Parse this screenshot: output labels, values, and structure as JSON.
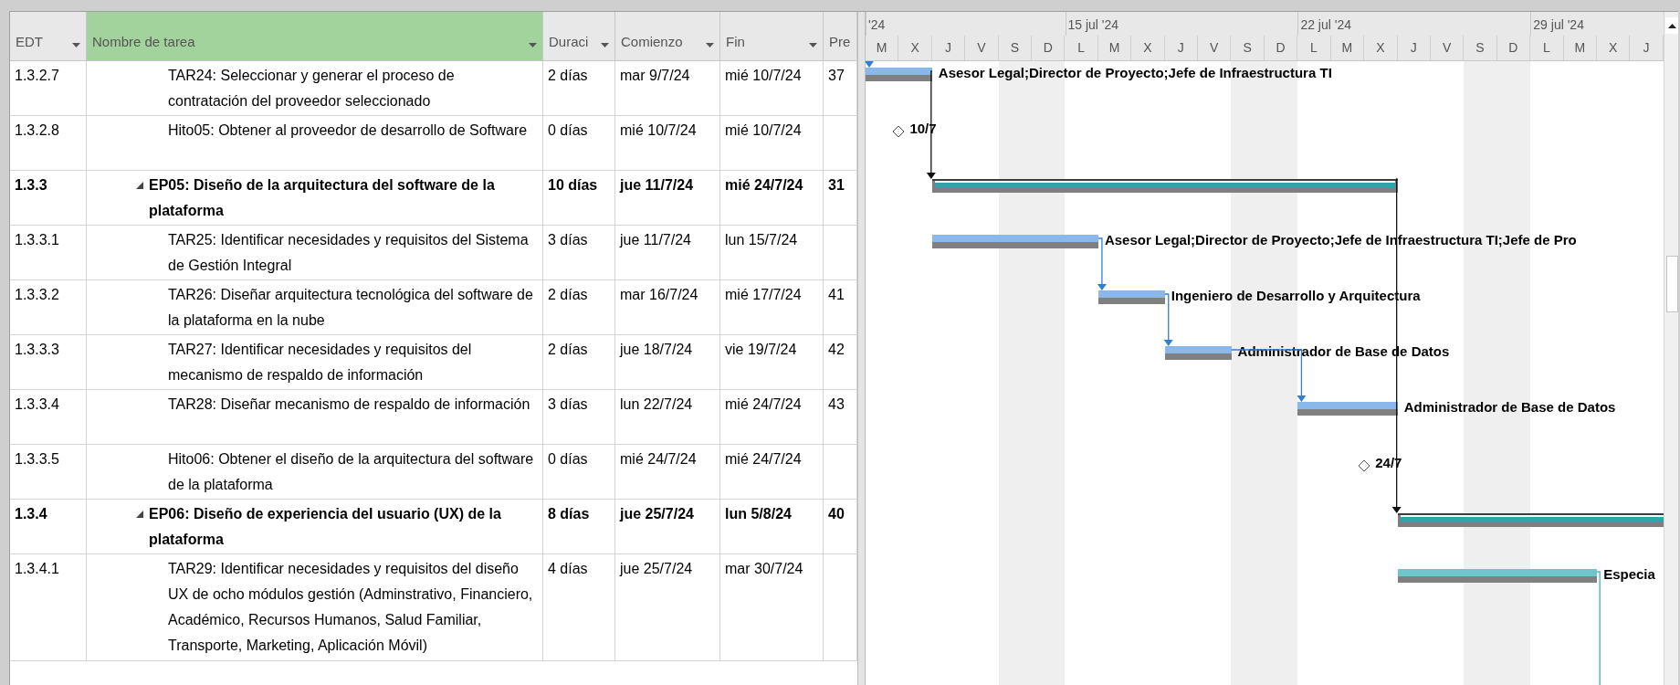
{
  "table": {
    "columns": [
      {
        "label": "EDT",
        "selected": false
      },
      {
        "label": "Nombre de tarea",
        "selected": true
      },
      {
        "label": "Duraci",
        "selected": false
      },
      {
        "label": "Comienzo",
        "selected": false
      },
      {
        "label": "Fin",
        "selected": false
      },
      {
        "label": "Pre",
        "selected": false
      }
    ],
    "rows": [
      {
        "kind": "task",
        "wbs": "1.3.2.7",
        "name": "TAR24: Seleccionar y generar el proceso de contratación del proveedor seleccionado",
        "duration": "2 días",
        "start": "mar 9/7/24",
        "finish": "mié 10/7/24",
        "predecessors": "37",
        "color": "#8ab8ea",
        "resources": "Asesor Legal;Director de Proyecto;Jefe de Infraestructura TI",
        "arrow_in": true
      },
      {
        "kind": "milestone",
        "wbs": "1.3.2.8",
        "name": "Hito05: Obtener al proveedor de desarrollo de Software",
        "duration": "0 días",
        "start": "mié 10/7/24",
        "finish": "mié 10/7/24",
        "milestone_label": "10/7"
      },
      {
        "kind": "summary",
        "wbs": "1.3.3",
        "name": "EP05: Diseño de la arquitectura del software de la plataforma",
        "expanded": true,
        "duration": "10 días",
        "start": "jue 11/7/24",
        "finish": "mié 24/7/24",
        "predecessors": "31",
        "arrow_in": true
      },
      {
        "kind": "task",
        "wbs": "1.3.3.1",
        "name": "TAR25: Identificar necesidades y requisitos del Sistema de Gestión Integral",
        "duration": "3 días",
        "start": "jue 11/7/24",
        "finish": "lun 15/7/24",
        "color": "#8ab8ea",
        "resources": "Asesor Legal;Director de Proyecto;Jefe de Infraestructura TI;Jefe de Pro"
      },
      {
        "kind": "task",
        "wbs": "1.3.3.2",
        "name": "TAR26: Diseñar arquitectura tecnológica del software de la plataforma en la nube",
        "duration": "2 días",
        "start": "mar 16/7/24",
        "finish": "mié 17/7/24",
        "predecessors": "41",
        "color": "#8ab8ea",
        "resources": "Ingeniero de Desarrollo y Arquitectura",
        "arrow_in": true
      },
      {
        "kind": "task",
        "wbs": "1.3.3.3",
        "name": "TAR27: Identificar necesidades y requisitos del mecanismo de respaldo de información",
        "duration": "2 días",
        "start": "jue 18/7/24",
        "finish": "vie 19/7/24",
        "predecessors": "42",
        "color": "#8ab8ea",
        "resources": "Administrador de Base de Datos",
        "arrow_in": true
      },
      {
        "kind": "task",
        "wbs": "1.3.3.4",
        "name": "TAR28: Diseñar mecanismo de respaldo de información",
        "duration": "3 días",
        "start": "lun 22/7/24",
        "finish": "mié 24/7/24",
        "predecessors": "43",
        "color": "#8ab8ea",
        "resources": "Administrador de Base de Datos",
        "arrow_in": true
      },
      {
        "kind": "milestone",
        "wbs": "1.3.3.5",
        "name": "Hito06: Obtener el diseño de la arquitectura del software de la plataforma",
        "duration": "0 días",
        "start": "mié 24/7/24",
        "finish": "mié 24/7/24",
        "milestone_label": "24/7"
      },
      {
        "kind": "summary",
        "wbs": "1.3.4",
        "name": "EP06: Diseño de experiencia del usuario (UX) de la plataforma",
        "expanded": true,
        "duration": "8 días",
        "start": "jue 25/7/24",
        "finish": "lun 5/8/24",
        "predecessors": "40",
        "arrow_in": true
      },
      {
        "kind": "task",
        "wbs": "1.3.4.1",
        "name": "TAR29: Identificar necesidades y requisitos del diseño UX de ocho módulos gestión (Adminstrativo, Financiero, Académico, Recursos Humanos, Salud Familiar, Transporte, Marketing, Aplicación Móvil)",
        "duration": "4 días",
        "start": "jue 25/7/24",
        "finish": "mar 30/7/24",
        "color": "#6cc6cc",
        "resources": "Especia",
        "arrow_out": true
      }
    ]
  },
  "timeline": {
    "weeks": [
      {
        "label": "'24"
      },
      {
        "label": "15 jul '24"
      },
      {
        "label": "22 jul '24"
      },
      {
        "label": "29 jul '24"
      }
    ],
    "days": [
      {
        "label": "M",
        "weekend": false
      },
      {
        "label": "X",
        "weekend": false
      },
      {
        "label": "J",
        "weekend": false
      },
      {
        "label": "V",
        "weekend": false
      },
      {
        "label": "S",
        "weekend": true
      },
      {
        "label": "D",
        "weekend": true
      },
      {
        "label": "L",
        "weekend": false
      },
      {
        "label": "M",
        "weekend": false
      },
      {
        "label": "X",
        "weekend": false
      },
      {
        "label": "J",
        "weekend": false
      },
      {
        "label": "V",
        "weekend": false
      },
      {
        "label": "S",
        "weekend": true
      },
      {
        "label": "D",
        "weekend": true
      },
      {
        "label": "L",
        "weekend": false
      },
      {
        "label": "M",
        "weekend": false
      },
      {
        "label": "X",
        "weekend": false
      },
      {
        "label": "J",
        "weekend": false
      },
      {
        "label": "V",
        "weekend": false
      },
      {
        "label": "S",
        "weekend": true
      },
      {
        "label": "D",
        "weekend": true
      },
      {
        "label": "L",
        "weekend": false
      },
      {
        "label": "M",
        "weekend": false
      },
      {
        "label": "X",
        "weekend": false
      },
      {
        "label": "J",
        "weekend": false
      }
    ]
  }
}
